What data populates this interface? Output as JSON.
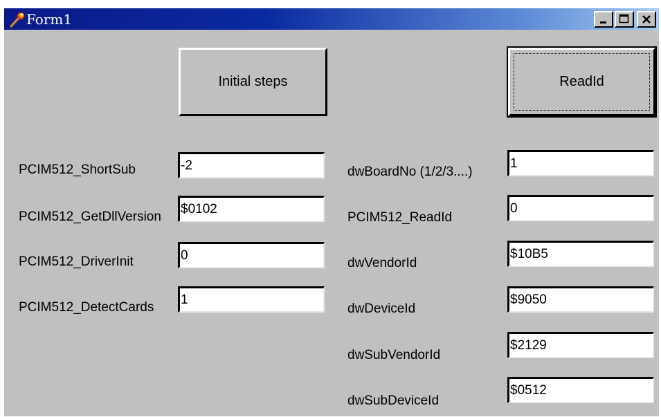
{
  "window": {
    "title": "Form1",
    "icon": "torch-icon"
  },
  "buttons": {
    "initial_steps": "Initial steps",
    "read_id": "ReadId"
  },
  "left_fields": [
    {
      "label": "PCIM512_ShortSub",
      "value": "-2"
    },
    {
      "label": "PCIM512_GetDllVersion",
      "value": "$0102"
    },
    {
      "label": "PCIM512_DriverInit",
      "value": "0"
    },
    {
      "label": "PCIM512_DetectCards",
      "value": "1"
    }
  ],
  "right_fields": [
    {
      "label": "dwBoardNo (1/2/3....)",
      "value": "1"
    },
    {
      "label": "PCIM512_ReadId",
      "value": "0"
    },
    {
      "label": "dwVendorId",
      "value": "$10B5"
    },
    {
      "label": "dwDeviceId",
      "value": "$9050"
    },
    {
      "label": "dwSubVendorId",
      "value": "$2129"
    },
    {
      "label": "dwSubDeviceId",
      "value": "$0512"
    }
  ],
  "colors": {
    "face": "#c0c0c0",
    "title_start": "#0a1a88",
    "title_end": "#a6caf0"
  }
}
